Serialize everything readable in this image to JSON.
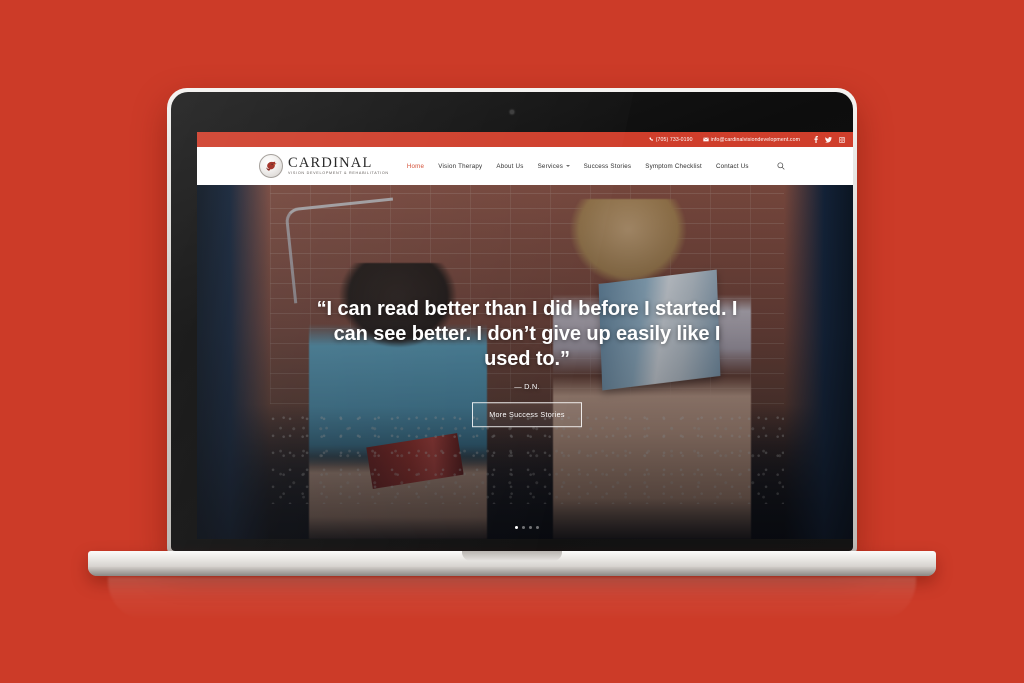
{
  "page": {
    "background_color": "#cc3b28",
    "device": "laptop-mockup"
  },
  "site": {
    "topbar": {
      "phone_icon": "phone-icon",
      "phone": "(705) 733-0190",
      "email_icon": "envelope-icon",
      "email": "info@cardinalvisiondevelopment.com",
      "background_color": "#cf3e2b",
      "social": [
        {
          "name": "facebook-icon",
          "label": "Facebook"
        },
        {
          "name": "twitter-icon",
          "label": "Twitter"
        },
        {
          "name": "instagram-icon",
          "label": "Instagram"
        }
      ]
    },
    "brand": {
      "mark": "cardinal-bird-logo-icon",
      "name": "CARDINAL",
      "tagline": "VISION DEVELOPMENT & REHABILITATION"
    },
    "nav": {
      "active_color": "#d2492f",
      "items": [
        {
          "label": "Home",
          "active": true,
          "has_dropdown": false
        },
        {
          "label": "Vision Therapy",
          "active": false,
          "has_dropdown": false
        },
        {
          "label": "About Us",
          "active": false,
          "has_dropdown": false
        },
        {
          "label": "Services",
          "active": false,
          "has_dropdown": true
        },
        {
          "label": "Success Stories",
          "active": false,
          "has_dropdown": false
        },
        {
          "label": "Symptom Checklist",
          "active": false,
          "has_dropdown": false
        },
        {
          "label": "Contact Us",
          "active": false,
          "has_dropdown": false
        }
      ],
      "search_icon": "search-icon"
    },
    "hero": {
      "image_description": "Two children sitting on concrete steps reading books against a red brick wall",
      "quote": "“I can read better than I did before I started. I can see better. I don’t give up easily like I used to.”",
      "attribution": "— D.N.",
      "cta_label": "More Success Stories",
      "slides": [
        {
          "active": true
        },
        {
          "active": false
        },
        {
          "active": false
        },
        {
          "active": false
        }
      ]
    }
  }
}
